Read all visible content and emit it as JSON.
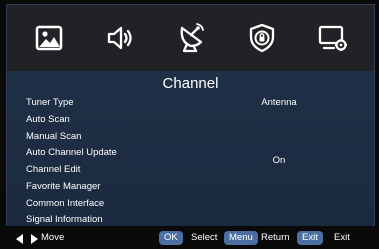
{
  "tabs": [
    {
      "name": "picture",
      "icon": "picture-icon"
    },
    {
      "name": "sound",
      "icon": "speaker-icon"
    },
    {
      "name": "channel",
      "icon": "satellite-dish-icon",
      "selected": true
    },
    {
      "name": "lock",
      "icon": "lock-shield-icon"
    },
    {
      "name": "setup",
      "icon": "screen-settings-icon"
    }
  ],
  "menu": {
    "title": "Channel",
    "items": [
      {
        "label": "Tuner Type",
        "value": "Antenna"
      },
      {
        "label": "Auto Scan",
        "value": ""
      },
      {
        "label": "Manual Scan",
        "value": ""
      },
      {
        "label": "Auto Channel Update",
        "value": "On"
      },
      {
        "label": "Channel Edit",
        "value": ""
      },
      {
        "label": "Favorite Manager",
        "value": ""
      },
      {
        "label": "Common Interface",
        "value": ""
      },
      {
        "label": "Signal Information",
        "value": ""
      }
    ]
  },
  "footer": {
    "move_label": "Move",
    "ok_key": "OK",
    "select_label": "Select",
    "menu_key": "Menu",
    "return_label": "Return",
    "exit_key": "Exit",
    "exit_label": "Exit"
  },
  "colors": {
    "panel_bg": "#1e2d40",
    "iconbar_bg": "#202225",
    "button_blue": "#4b6fa2",
    "icon_color": "#ffffff"
  }
}
